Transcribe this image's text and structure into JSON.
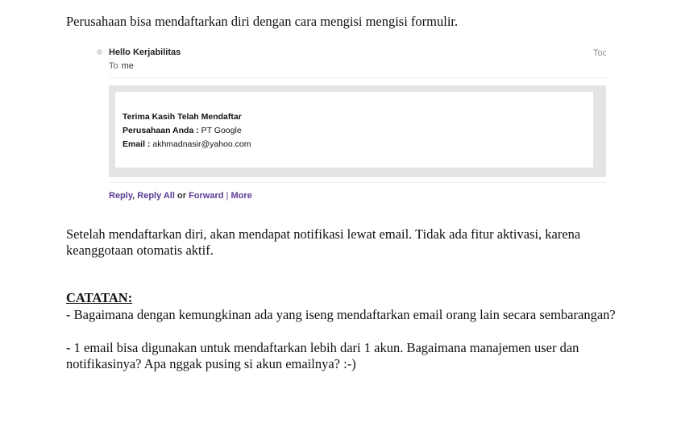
{
  "intro": "Perusahaan bisa mendaftarkan diri dengan cara mengisi mengisi formulir.",
  "email": {
    "sender": "Hello Kerjabilitas",
    "date_partial": "Toc",
    "to_label": "To",
    "to_value": "me",
    "body": {
      "title": "Terima Kasih Telah Mendaftar",
      "company_label": "Perusahaan Anda :",
      "company_value": "PT Google",
      "email_label": "Email :",
      "email_value": "akhmadnasir@yahoo.com"
    },
    "actions": {
      "reply": "Reply",
      "reply_all": "Reply All",
      "or": "or",
      "forward": "Forward",
      "separator": "|",
      "more": "More"
    }
  },
  "notice": "Setelah mendaftarkan diri, akan mendapat notifikasi lewat email. Tidak ada fitur aktivasi, karena keanggotaan otomatis aktif.",
  "catatan": {
    "title": "CATATAN:",
    "items": [
      "- Bagaimana dengan kemungkinan ada yang iseng mendaftarkan email orang lain secara sembarangan?",
      "- 1 email bisa digunakan untuk mendaftarkan lebih dari 1 akun. Bagaimana manajemen user dan notifikasinya? Apa nggak pusing si akun emailnya? :-)"
    ]
  }
}
